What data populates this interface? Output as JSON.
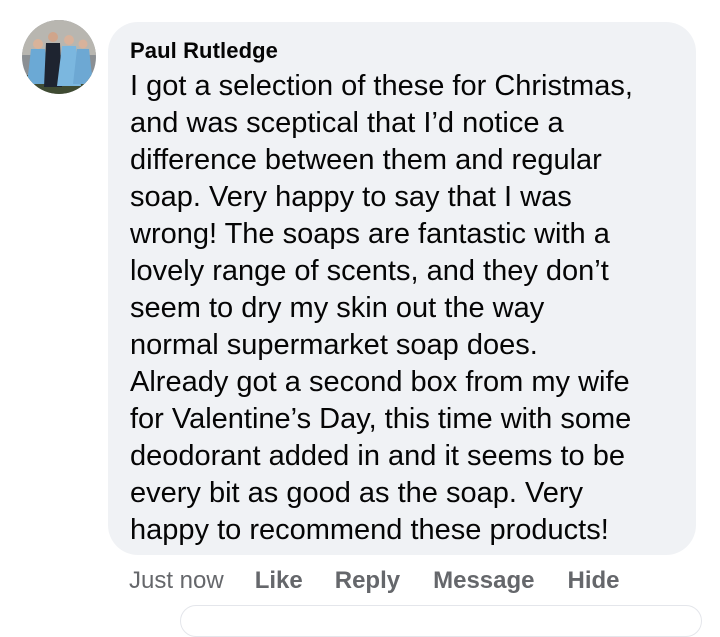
{
  "comment": {
    "author": "Paul Rutledge",
    "text": "I got a selection of these for Christmas,\nand was sceptical that I’d notice a\ndifference between them and regular\nsoap. Very happy to say that I was\nwrong! The soaps are fantastic with a\nlovely range of scents, and they don’t\nseem to dry my skin out the way\nnormal supermarket soap does.\nAlready got a second box from my wife\nfor Valentine’s Day, this time with some\ndeodorant added in and it seems to be\nevery bit as good as the soap. Very\nhappy to recommend these products!",
    "timestamp": "Just now",
    "actions": {
      "like": "Like",
      "reply": "Reply",
      "message": "Message",
      "hide": "Hide"
    }
  },
  "colors": {
    "bubble_background": "#f0f2f5",
    "author_text": "#050505",
    "body_text": "#050505",
    "secondary_text": "#65676b"
  }
}
